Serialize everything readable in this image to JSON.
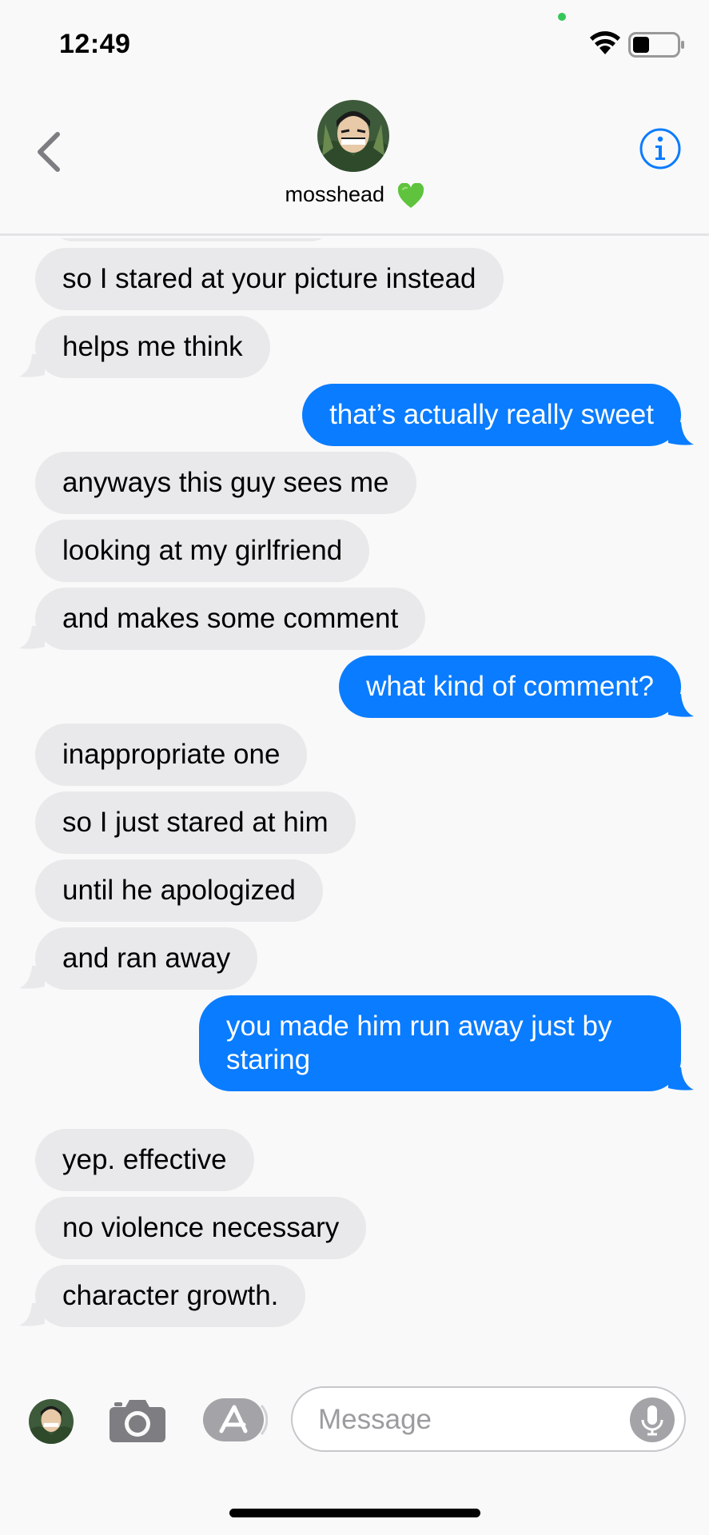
{
  "status_bar": {
    "time": "12:49"
  },
  "header": {
    "contact_name": "mosshead",
    "contact_emoji": "green-heart",
    "back_icon": "chevron-left-icon",
    "info_icon": "info-icon"
  },
  "messages": [
    {
      "dir": "in",
      "text": "so I stared at your picture instead"
    },
    {
      "dir": "in",
      "text": "helps me think"
    },
    {
      "dir": "out",
      "text": "that’s actually really sweet"
    },
    {
      "dir": "in",
      "text": "anyways this guy sees me"
    },
    {
      "dir": "in",
      "text": "looking at my girlfriend"
    },
    {
      "dir": "in",
      "text": "and makes some comment"
    },
    {
      "dir": "out",
      "text": "what kind of comment?"
    },
    {
      "dir": "in",
      "text": "inappropriate one"
    },
    {
      "dir": "in",
      "text": "so I just stared at him"
    },
    {
      "dir": "in",
      "text": "until he apologized"
    },
    {
      "dir": "in",
      "text": "and ran away"
    },
    {
      "dir": "out",
      "text": "you made him run away just by staring"
    },
    {
      "dir": "in",
      "text": "yep. effective"
    },
    {
      "dir": "in",
      "text": "no violence necessary"
    },
    {
      "dir": "in",
      "text": "character growth."
    }
  ],
  "input_bar": {
    "placeholder": "Message"
  },
  "colors": {
    "incoming_bubble": "#e9e9eb",
    "outgoing_bubble": "#0a7cff",
    "accent": "#0a7cff"
  }
}
